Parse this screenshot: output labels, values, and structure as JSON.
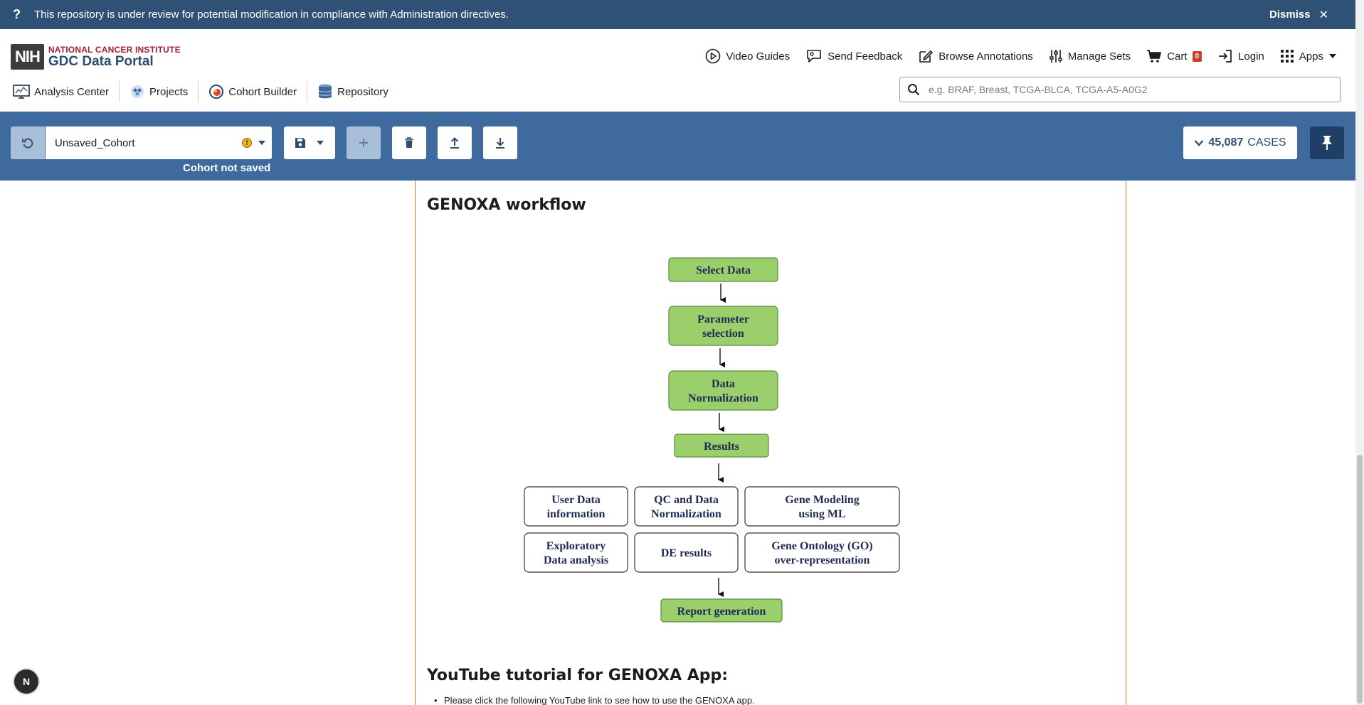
{
  "banner": {
    "icon": "question-icon",
    "message": "This repository is under review for potential modification in compliance with Administration directives.",
    "dismiss_label": "Dismiss"
  },
  "logo": {
    "badge": "NIH",
    "org": "NATIONAL CANCER INSTITUTE",
    "portal": "GDC Data Portal"
  },
  "top_nav": {
    "video_guides": "Video Guides",
    "send_feedback": "Send Feedback",
    "browse_annotations": "Browse Annotations",
    "manage_sets": "Manage Sets",
    "cart": "Cart",
    "cart_count": "0",
    "login": "Login",
    "apps": "Apps"
  },
  "sub_nav": {
    "analysis_center": "Analysis Center",
    "projects": "Projects",
    "cohort_builder": "Cohort Builder",
    "repository": "Repository"
  },
  "search": {
    "placeholder": "e.g. BRAF, Breast, TCGA-BLCA, TCGA-A5-A0G2"
  },
  "cohort": {
    "name": "Unsaved_Cohort",
    "status": "Cohort not saved",
    "case_count": "45,087",
    "case_label": "CASES"
  },
  "content": {
    "workflow_title": "GENOXA workflow",
    "youtube_title": "YouTube tutorial for GENOXA App:",
    "bullet_text": "Please click the following YouTube link to see how to use the GENOXA app."
  },
  "workflow": {
    "select_data": "Select Data",
    "parameter_selection": [
      "Parameter",
      "selection"
    ],
    "data_normalization": [
      "Data",
      "Normalization"
    ],
    "results": "Results",
    "user_data_info": [
      "User Data",
      "information"
    ],
    "qc_normalization": [
      "QC and Data",
      "Normalization"
    ],
    "gene_modeling": [
      "Gene Modeling",
      "using ML"
    ],
    "exploratory": [
      "Exploratory",
      "Data analysis"
    ],
    "de_results": "DE results",
    "gene_ontology": [
      "Gene Ontology (GO)",
      "over-representation"
    ],
    "report_generation": "Report generation"
  },
  "fab_label": "N",
  "colors": {
    "banner_bg": "#2f5176",
    "cohort_bar_bg": "#3e6a9e",
    "green_box": "#9bcf6b",
    "accent_orange": "#d9782b"
  }
}
